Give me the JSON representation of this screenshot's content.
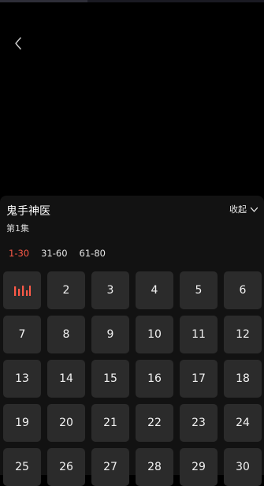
{
  "player": {
    "back_icon": "chevron-left-icon",
    "progress": 0.33
  },
  "panel": {
    "title": "鬼手神医",
    "subtitle": "第1集",
    "collapse_label": "收起",
    "collapse_icon": "chevron-down-icon"
  },
  "ranges": [
    "1-30",
    "31-60",
    "61-80"
  ],
  "active_range": 0,
  "accent_color": "#ff5a48",
  "playing_icon": "equalizer-playing-icon",
  "playing_episode": 1,
  "episodes": [
    "1",
    "2",
    "3",
    "4",
    "5",
    "6",
    "7",
    "8",
    "9",
    "10",
    "11",
    "12",
    "13",
    "14",
    "15",
    "16",
    "17",
    "18",
    "19",
    "20",
    "21",
    "22",
    "23",
    "24",
    "25",
    "26",
    "27",
    "28",
    "29",
    "30"
  ]
}
